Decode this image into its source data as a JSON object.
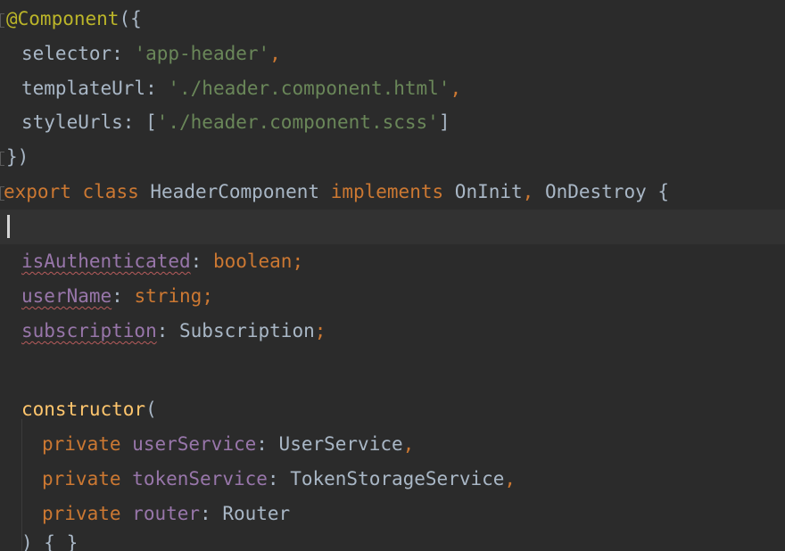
{
  "code": {
    "l1_decorator": "@Component",
    "l1_rest": "({",
    "l2_key": "selector",
    "l2_colon": ": ",
    "l2_value": "'app-header'",
    "l2_comma": ",",
    "l3_key": "templateUrl",
    "l3_colon": ": ",
    "l3_value": "'./header.component.html'",
    "l3_comma": ",",
    "l4_key": "styleUrls",
    "l4_colon": ": [",
    "l4_value": "'./header.component.scss'",
    "l4_close": "]",
    "l5": "})",
    "l6_export": "export",
    "l6_class": "class",
    "l6_name": "HeaderComponent",
    "l6_implements": "implements",
    "l6_iface1": "OnInit",
    "l6_comma": ", ",
    "l6_iface2": "OnDestroy",
    "l6_brace": "{",
    "l8_field": "isAuthenticated",
    "l8_colon": ": ",
    "l8_type": "boolean",
    "l8_semi": ";",
    "l9_field": "userName",
    "l9_colon": ": ",
    "l9_type": "string",
    "l9_semi": ";",
    "l10_field": "subscription",
    "l10_colon": ": ",
    "l10_type": "Subscription",
    "l10_semi": ";",
    "l12_ctor": "constructor",
    "l12_paren": "(",
    "l13_private": "private",
    "l13_param": "userService",
    "l13_colon": ": ",
    "l13_type": "UserService",
    "l13_comma": ",",
    "l14_private": "private",
    "l14_param": "tokenService",
    "l14_colon": ": ",
    "l14_type": "TokenStorageService",
    "l14_comma": ",",
    "l15_private": "private",
    "l15_param": "router",
    "l15_colon": ": ",
    "l15_type": "Router",
    "l16": ") { }"
  },
  "colors": {
    "background": "#2b2b2b",
    "current_line": "#323232",
    "annotation": "#bbb529",
    "keyword": "#cc7832",
    "string": "#6a8759",
    "field": "#9876aa",
    "plain": "#a9b7c6"
  }
}
